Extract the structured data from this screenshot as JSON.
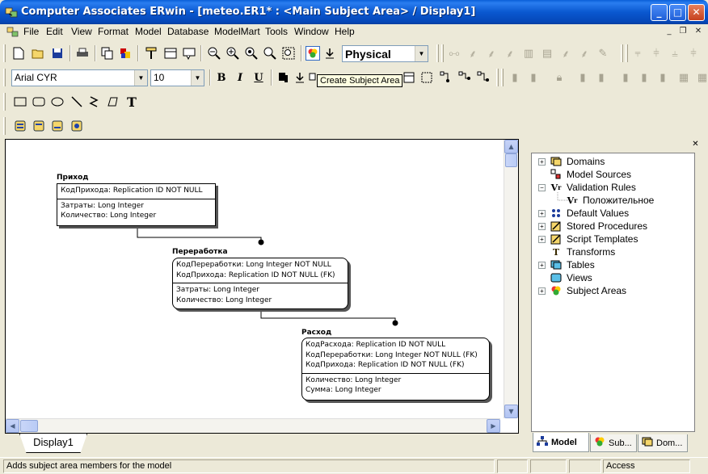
{
  "window": {
    "title": "Computer Associates ERwin - [meteo.ER1* : <Main Subject Area> / Display1]",
    "min": "_",
    "max": "□",
    "close": "✕"
  },
  "menu": {
    "items": [
      "File",
      "Edit",
      "View",
      "Format",
      "Model",
      "Database",
      "ModelMart",
      "Tools",
      "Window",
      "Help"
    ],
    "mdi_min": "_",
    "mdi_restore": "❐",
    "mdi_close": "✕"
  },
  "toolbar": {
    "view_mode": "Physical",
    "font_name": "Arial CYR",
    "font_size": "10",
    "bold": "B",
    "italic": "I",
    "underline": "U",
    "text_tool": "T"
  },
  "tooltip": "Create Subject Area",
  "diagram": {
    "entities": [
      {
        "title": "Приход",
        "keys": [
          "КодПрихода: Replication ID NOT NULL"
        ],
        "attrs": [
          "Затраты: Long Integer",
          "Количество: Long Integer"
        ]
      },
      {
        "title": "Переработка",
        "keys": [
          "КодПереработки: Long Integer NOT NULL",
          "КодПрихода: Replication ID NOT NULL (FK)"
        ],
        "attrs": [
          "Затраты: Long Integer",
          "Количество: Long Integer"
        ]
      },
      {
        "title": "Расход",
        "keys": [
          "КодРасхода: Replication ID NOT NULL",
          "КодПереработки: Long Integer NOT NULL (FK)",
          "КодПрихода: Replication ID NOT NULL (FK)"
        ],
        "attrs": [
          "Количество: Long Integer",
          "Сумма: Long Integer"
        ]
      }
    ],
    "tab": "Display1"
  },
  "panel": {
    "close": "✕",
    "tree": [
      {
        "label": "Domains",
        "icon": "domains-icon",
        "expander": "+"
      },
      {
        "label": "Model Sources",
        "icon": "model-sources-icon",
        "expander": ""
      },
      {
        "label": "Validation Rules",
        "icon": "validation-rules-icon",
        "expander": "−"
      },
      {
        "label": "Положительное",
        "icon": "validation-rule-icon",
        "expander": ""
      },
      {
        "label": "Default Values",
        "icon": "default-values-icon",
        "expander": "+"
      },
      {
        "label": "Stored Procedures",
        "icon": "stored-procedures-icon",
        "expander": "+"
      },
      {
        "label": "Script Templates",
        "icon": "script-templates-icon",
        "expander": "+"
      },
      {
        "label": "Transforms",
        "icon": "transforms-icon",
        "expander": ""
      },
      {
        "label": "Tables",
        "icon": "tables-icon",
        "expander": "+"
      },
      {
        "label": "Views",
        "icon": "views-icon",
        "expander": ""
      },
      {
        "label": "Subject Areas",
        "icon": "subject-areas-icon",
        "expander": "+"
      }
    ],
    "tabs": [
      "Model",
      "Sub...",
      "Dom..."
    ]
  },
  "status": {
    "message": "Adds subject area members for the model",
    "access": "Access"
  }
}
